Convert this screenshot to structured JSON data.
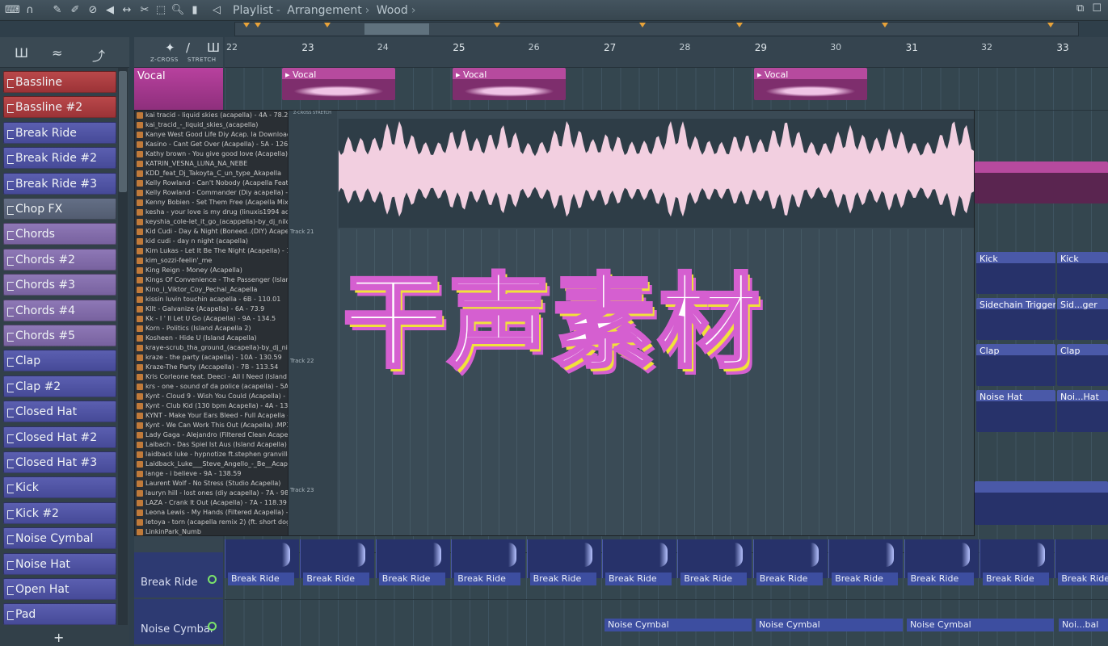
{
  "topbar": {
    "breadcrumb": [
      "Playlist",
      "Arrangement",
      "Wood"
    ],
    "window_controls": [
      "restore-icon",
      "maximize-icon"
    ]
  },
  "ruler": {
    "bars": [
      "22",
      "23",
      "24",
      "25",
      "26",
      "27",
      "28",
      "29",
      "30",
      "31",
      "32",
      "33"
    ]
  },
  "toolbar": {
    "crossfade_label": "Z-CROSS",
    "stretch_label": "STRETCH"
  },
  "channels": [
    {
      "label": "Bassline",
      "color": "red"
    },
    {
      "label": "Bassline #2",
      "color": "red"
    },
    {
      "label": "Break Ride",
      "color": "blue"
    },
    {
      "label": "Break Ride #2",
      "color": "blue"
    },
    {
      "label": "Break Ride #3",
      "color": "blue"
    },
    {
      "label": "Chop FX",
      "color": "grey"
    },
    {
      "label": "Chords",
      "color": "purple"
    },
    {
      "label": "Chords #2",
      "color": "purple"
    },
    {
      "label": "Chords #3",
      "color": "purple"
    },
    {
      "label": "Chords #4",
      "color": "purple"
    },
    {
      "label": "Chords #5",
      "color": "purple"
    },
    {
      "label": "Clap",
      "color": "blue"
    },
    {
      "label": "Clap #2",
      "color": "blue"
    },
    {
      "label": "Closed Hat",
      "color": "blue"
    },
    {
      "label": "Closed Hat #2",
      "color": "blue"
    },
    {
      "label": "Closed Hat #3",
      "color": "blue"
    },
    {
      "label": "Kick",
      "color": "blue"
    },
    {
      "label": "Kick #2",
      "color": "blue"
    },
    {
      "label": "Noise Cymbal",
      "color": "blue"
    },
    {
      "label": "Noise Hat",
      "color": "blue"
    },
    {
      "label": "Open Hat",
      "color": "blue"
    },
    {
      "label": "Pad",
      "color": "blue"
    }
  ],
  "tracks": {
    "vocal": "Vocal",
    "break_ride": "Break Ride",
    "noise_cymbal": "Noise Cymbal"
  },
  "clips": {
    "vocal": "Vocal",
    "kick": "Kick",
    "sidechain": "Sidechain Trigger",
    "sidechain_short": "Sid...ger",
    "clap": "Clap",
    "noise_hat": "Noise Hat",
    "noise_hat_short": "Noi...Hat",
    "break_ride": "Break Ride",
    "noise_cymbal": "Noise Cymbal",
    "noise_cymbal_short": "Noi...bal"
  },
  "browser": {
    "files": [
      "kai tracid - liquid skies (acapella) - 4A - 78.2",
      "kai_tracid_-_liquid_skies_(acapella)",
      "Kanye West Good Life Diy Acap. la Download Lyrics - 3B - 107",
      "Kasino - Cant Get Over (Acapella) - 5A - 126.98",
      "Kathy brown - You give good love (Acapella) - 5A - 94.14",
      "KATRIN_VESNA_LUNA_NA_NEBE",
      "KDD_feat_Dj_Takoyta_C_un_type_Akapella",
      "Kelly Rowland - Can't Nobody (Acapella Feat Jakk Frost) - 2B",
      "Kelly Rowland - Commander (Diy acapella) - 11B - 124.42",
      "Kenny Bobien - Set Them Free (Acapella Mix) - 7A - 126.28",
      "kesha - your love is my drug (linuxis1994 acapella) - 2B - 7",
      "keyshia_cole-let_it_go_(acappella)-by_dj_nilo",
      "Kid Cudi - Day & Night (Boneed..(DIY) Acapella)Reworked 1 -",
      "kid cudi - day n night (acapella)",
      "Kim Lukas - Let It Be The Night (Acapella) - 12A - 127.9",
      "kim_sozzi-feelin'_me",
      "King Reign - Money (Acapella)",
      "Kings Of Convenience - The Passenger (Island Acapella)",
      "Kino_i_Viktor_Coy_Pechal_Acapella",
      "kissin luvin touchin acapella - 6B - 110.01",
      "Kllt - Galvanize (Acapella) - 6A - 73.9",
      "Kk - I ' ll Let U Go (Acapella) - 9A - 134.5",
      "Korn - Politics (Island Acapella 2)",
      "Kosheen - Hide U (Island Acapella)",
      "kraye-scrub_tha_ground_(acapella)-by_dj_nilo",
      "kraze - the party (acapella) - 10A - 130.59",
      "Kraze-The Party (Accapella) - 7B - 113.54",
      "Kris Corleone feat. Deeci - All I Need (Island Diy Acapella)",
      "krs - one - sound of da police (acapella) - 5A - 99.46",
      "Kynt - Cloud 9 - Wish You Could (Acapella) - 2A - 84.4",
      "Kynt - Club Kid (130 bpm Acapella) - 4A - 132.19",
      "KYNT - Make Your Ears Bleed - Full Acapella - 12A - 157.24",
      "Kynt - We Can Work This Out (Acapella) .MP3 - 2A - 70.53",
      "Lady Gaga - Alejandro (Filtered Clean Acapella) - 10A - 98.9",
      "Laibach - Das Spiel Ist Aus (Island Acapella)",
      "laidback luke - hypnotize ft.stephen granville (acapella) -",
      "Laidback_Luke___Steve_Angello_-_Be__Acapella",
      "lange - i believe - 9A - 138.59",
      "Laurent Wolf - No Stress (Studio Acapella)",
      "lauryn hill - lost ones (diy acapella) - 7A - 98.15",
      "LAZA - Crank It Out (Acapella) - 7A - 118.39",
      "Leona Lewis - My Hands (Filtered Acapella) - 3B - 100.79",
      "letoya - torn (acapella remix 2) (ft. short dogg and rick ro",
      "LinkinPark_Numb"
    ]
  },
  "waveview": {
    "track_labels": [
      "Track 21",
      "Track 22",
      "Track 23"
    ],
    "toolbar_text": "Z-CROSS STRETCH"
  },
  "overlay": {
    "headline": "干声素材"
  },
  "colors": {
    "vocal": "#b8419e",
    "headline_fill": "#ffffff",
    "headline_stroke": "#d55fd0",
    "headline_shadow": "#f1e23a"
  }
}
